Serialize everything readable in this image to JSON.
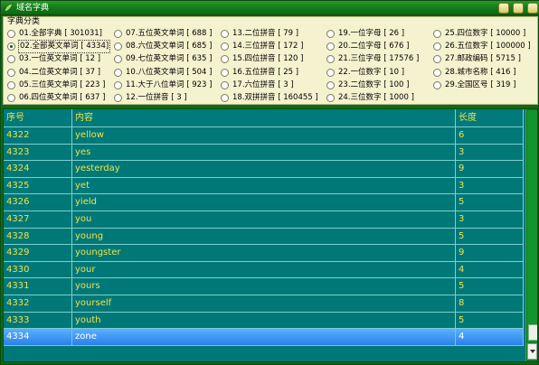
{
  "window": {
    "title": "域名字典"
  },
  "categories": {
    "legend": "字典分类",
    "options": [
      {
        "label": "01.全部字典 [ 301031]",
        "selected": false
      },
      {
        "label": "02.全部英文单词 [ 4334]",
        "selected": true
      },
      {
        "label": "03.一位英文单词 [ 12 ]",
        "selected": false
      },
      {
        "label": "04.二位英文单词 [ 37 ]",
        "selected": false
      },
      {
        "label": "05.三位英文单词 [ 223 ]",
        "selected": false
      },
      {
        "label": "06.四位英文单词 [ 637 ]",
        "selected": false
      },
      {
        "label": "07.五位英文单词 [ 688 ]",
        "selected": false
      },
      {
        "label": "08.六位英文单词 [ 685 ]",
        "selected": false
      },
      {
        "label": "09.七位英文单词 [ 635 ]",
        "selected": false
      },
      {
        "label": "10.八位英文单词 [ 504 ]",
        "selected": false
      },
      {
        "label": "11.大于八位单词 [ 923 ]",
        "selected": false
      },
      {
        "label": "12.一位拼音 [ 3 ]",
        "selected": false
      },
      {
        "label": "13.二位拼音 [ 79 ]",
        "selected": false
      },
      {
        "label": "14.三位拼音 [ 172 ]",
        "selected": false
      },
      {
        "label": "15.四位拼音 [ 120 ]",
        "selected": false
      },
      {
        "label": "16.五位拼音 [ 25 ]",
        "selected": false
      },
      {
        "label": "17.六位拼音 [ 3 ]",
        "selected": false
      },
      {
        "label": "18.双拼拼音 [ 160455 ]",
        "selected": false
      },
      {
        "label": "19.一位字母 [ 26 ]",
        "selected": false
      },
      {
        "label": "20.二位字母 [ 676 ]",
        "selected": false
      },
      {
        "label": "21.三位字母 [ 17576 ]",
        "selected": false
      },
      {
        "label": "22.一位数字 [ 10 ]",
        "selected": false
      },
      {
        "label": "23.二位数字 [ 100 ]",
        "selected": false
      },
      {
        "label": "24.三位数字 [ 1000 ]",
        "selected": false
      },
      {
        "label": "25.四位数字 [ 10000 ]",
        "selected": false
      },
      {
        "label": "26.五位数字 [ 100000 ]",
        "selected": false
      },
      {
        "label": "27.邮政编码 [ 5715 ]",
        "selected": false
      },
      {
        "label": "28.城市名称 [ 416 ]",
        "selected": false
      },
      {
        "label": "29.全国区号 [ 319 ]",
        "selected": false
      }
    ]
  },
  "table": {
    "columns": [
      "序号",
      "内容",
      "长度"
    ],
    "rows": [
      {
        "id": "4322",
        "word": "yellow",
        "length": "6"
      },
      {
        "id": "4323",
        "word": "yes",
        "length": "3"
      },
      {
        "id": "4324",
        "word": "yesterday",
        "length": "9"
      },
      {
        "id": "4325",
        "word": "yet",
        "length": "3"
      },
      {
        "id": "4326",
        "word": "yield",
        "length": "5"
      },
      {
        "id": "4327",
        "word": "you",
        "length": "3"
      },
      {
        "id": "4328",
        "word": "young",
        "length": "5"
      },
      {
        "id": "4329",
        "word": "youngster",
        "length": "9"
      },
      {
        "id": "4330",
        "word": "your",
        "length": "4"
      },
      {
        "id": "4331",
        "word": "yours",
        "length": "5"
      },
      {
        "id": "4332",
        "word": "yourself",
        "length": "8"
      },
      {
        "id": "4333",
        "word": "youth",
        "length": "5"
      },
      {
        "id": "4334",
        "word": "zone",
        "length": "4"
      }
    ],
    "selected_row": "4334",
    "scroll_position": 1.0
  },
  "colors": {
    "window_green": "#0c6a18",
    "panel_bg": "#f5f2cf",
    "grid_bg": "#007878",
    "grid_text": "#f0e24a",
    "selection": "#3a90f0"
  }
}
